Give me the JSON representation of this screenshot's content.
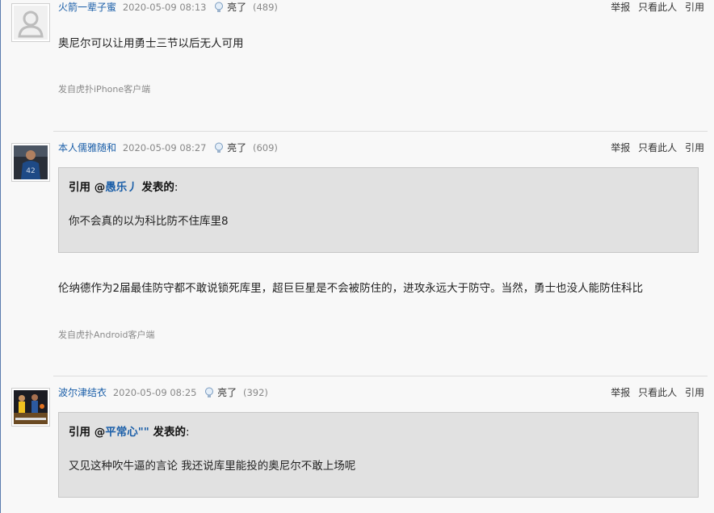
{
  "posts": [
    {
      "username": "火箭一辈子蜜",
      "time": "2020-05-09 08:13",
      "light_label": "亮了",
      "light_count": "(489)",
      "avatar": "default-avatar-icon",
      "body": "奥尼尔可以让用勇士三节以后无人可用",
      "source": "发自虎扑iPhone客户端"
    },
    {
      "username": "本人儒雅随和",
      "time": "2020-05-09 08:27",
      "light_label": "亮了",
      "light_count": "(609)",
      "avatar": "basketball-player-avatar",
      "quote": {
        "prefix": "引用 @",
        "mention": "愚乐丿",
        "suffix": " 发表的",
        "colon": ":",
        "text": "你不会真的以为科比防不住库里8"
      },
      "body": "伦纳德作为2届最佳防守都不敢说锁死库里，超巨巨星是不会被防住的，进攻永远大于防守。当然，勇士也没人能防住科比",
      "source": "发自虎扑Android客户端"
    },
    {
      "username": "波尔津结衣",
      "time": "2020-05-09 08:25",
      "light_label": "亮了",
      "light_count": "(392)",
      "avatar": "basketball-player-avatar",
      "quote": {
        "prefix": "引用 @",
        "mention": "平常心\"\"",
        "suffix": " 发表的",
        "colon": ":",
        "text": "又见这种吹牛逼的言论 我还说库里能投的奥尼尔不敢上场呢"
      }
    }
  ],
  "actions": {
    "report": "举报",
    "only_this": "只看此人",
    "quote": "引用"
  },
  "colors": {
    "username": "#1a5ea8",
    "quote_bg": "#e1e1e1",
    "page_bg": "#f8f8f8"
  }
}
